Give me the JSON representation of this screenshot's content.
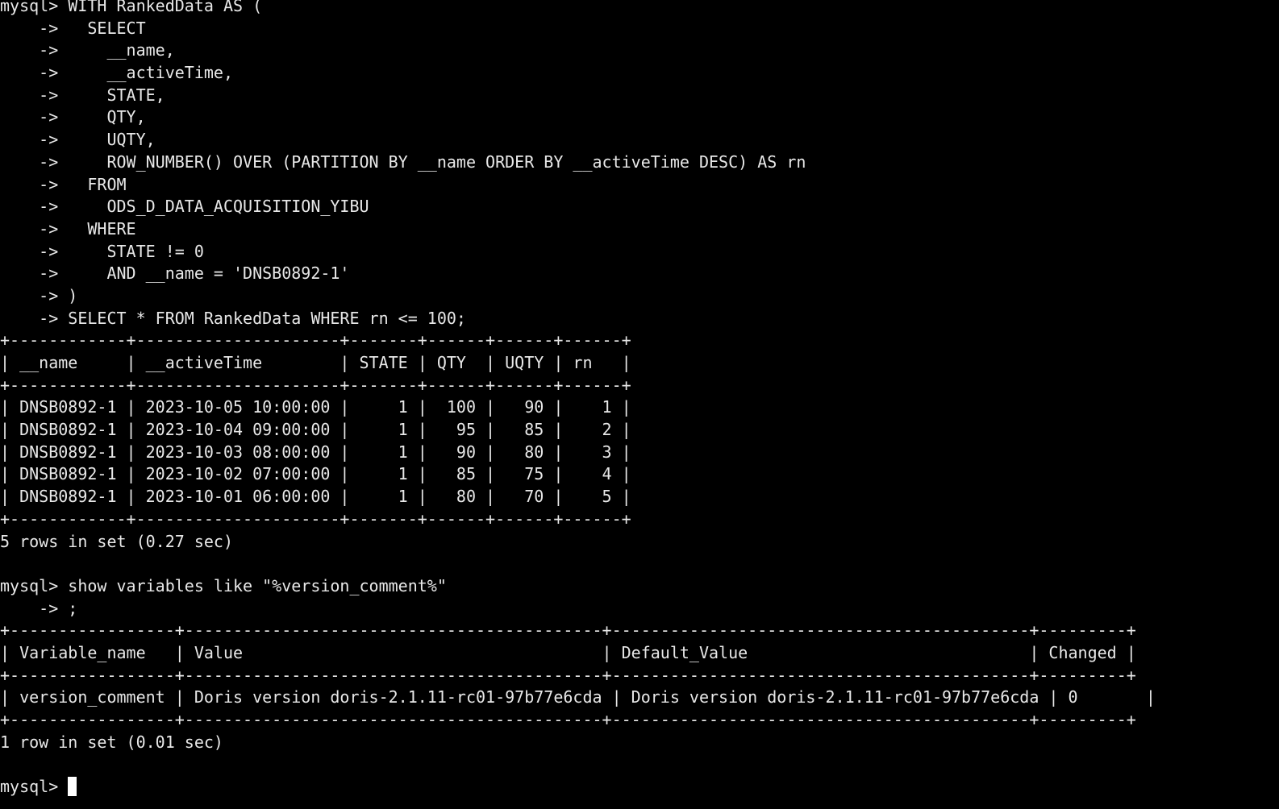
{
  "terminal": {
    "background": "#000000",
    "foreground": "#e8e8e8",
    "prompt": "mysql> ",
    "lines": [
      "mysql> WITH RankedData AS (",
      "    ->   SELECT",
      "    ->     __name,",
      "    ->     __activeTime,",
      "    ->     STATE,",
      "    ->     QTY,",
      "    ->     UQTY,",
      "    ->     ROW_NUMBER() OVER (PARTITION BY __name ORDER BY __activeTime DESC) AS rn",
      "    ->   FROM",
      "    ->     ODS_D_DATA_ACQUISITION_YIBU",
      "    ->   WHERE",
      "    ->     STATE != 0",
      "    ->     AND __name = 'DNSB0892-1'",
      "    -> )",
      "    -> SELECT * FROM RankedData WHERE rn <= 100;",
      "+------------+---------------------+-------+------+------+------+",
      "| __name     | __activeTime        | STATE | QTY  | UQTY | rn   |",
      "+------------+---------------------+-------+------+------+------+",
      "| DNSB0892-1 | 2023-10-05 10:00:00 |     1 |  100 |   90 |    1 |",
      "| DNSB0892-1 | 2023-10-04 09:00:00 |     1 |   95 |   85 |    2 |",
      "| DNSB0892-1 | 2023-10-03 08:00:00 |     1 |   90 |   80 |    3 |",
      "| DNSB0892-1 | 2023-10-02 07:00:00 |     1 |   85 |   75 |    4 |",
      "| DNSB0892-1 | 2023-10-01 06:00:00 |     1 |   80 |   70 |    5 |",
      "+------------+---------------------+-------+------+------+------+",
      "5 rows in set (0.27 sec)",
      "",
      "mysql> show variables like \"%version_comment%\"",
      "    -> ;",
      "+-----------------+-------------------------------------------+-------------------------------------------+---------+",
      "| Variable_name   | Value                                     | Default_Value                             | Changed |",
      "+-----------------+-------------------------------------------+-------------------------------------------+---------+",
      "| version_comment | Doris version doris-2.1.11-rc01-97b77e6cda | Doris version doris-2.1.11-rc01-97b77e6cda | 0       |",
      "+-----------------+-------------------------------------------+-------------------------------------------+---------+",
      "1 row in set (0.01 sec)",
      ""
    ],
    "final_prompt": "mysql> "
  }
}
